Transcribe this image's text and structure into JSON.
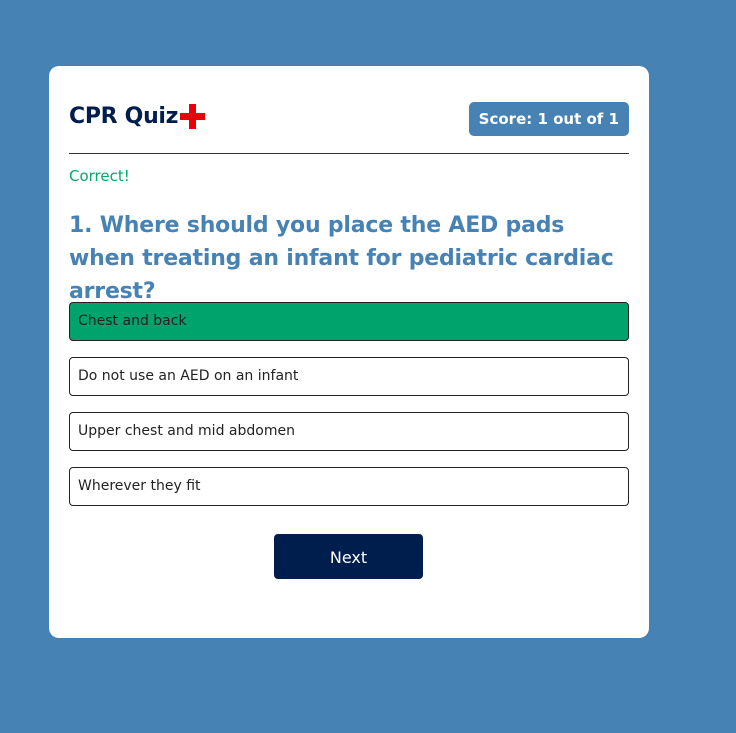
{
  "quiz": {
    "title": "CPR Quiz",
    "score_label": "Score: 1 out of 1",
    "feedback": "Correct!",
    "question": "1. Where should you place the AED pads when treating an infant for pediatric cardiac arrest?",
    "answers": [
      {
        "label": "Chest and back",
        "state": "correct"
      },
      {
        "label": "Do not use an AED on an infant",
        "state": "neutral"
      },
      {
        "label": "Upper chest and mid abdomen",
        "state": "neutral"
      },
      {
        "label": "Wherever they fit",
        "state": "neutral"
      }
    ],
    "next_label": "Next"
  },
  "colors": {
    "page_background": "#4682b4",
    "title": "#001e4d",
    "cross": "#e8000b",
    "feedback": "#0aa56a",
    "correct_answer": "#00a36c",
    "next_button": "#001e4d"
  },
  "icons": {
    "title_icon": "red-cross-icon"
  }
}
